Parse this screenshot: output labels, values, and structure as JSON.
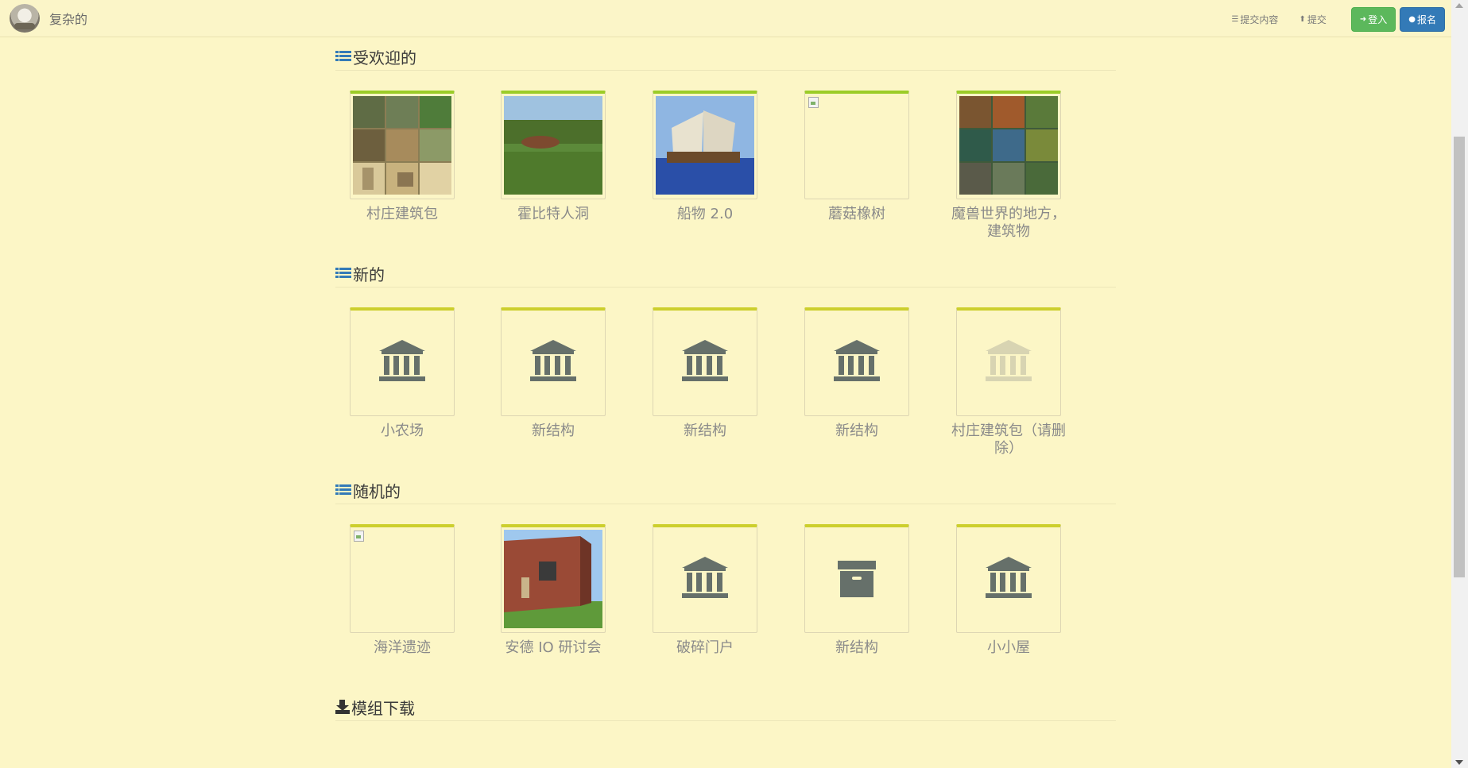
{
  "navbar": {
    "brand": "复杂的",
    "submissions_link": "提交内容",
    "submit_link": "提交",
    "login_button": "登入",
    "signup_button": "报名"
  },
  "sections": [
    {
      "title": "受欢迎的",
      "items": [
        {
          "label": "村庄建筑包",
          "thumb": "image"
        },
        {
          "label": "霍比特人洞",
          "thumb": "image"
        },
        {
          "label": "船物 2.0",
          "thumb": "image"
        },
        {
          "label": "蘑菇橡树",
          "thumb": "broken-image"
        },
        {
          "label": "魔兽世界的地方，建筑物",
          "thumb": "image"
        }
      ]
    },
    {
      "title": "新的",
      "items": [
        {
          "label": "小农场",
          "thumb": "bank-icon"
        },
        {
          "label": "新结构",
          "thumb": "bank-icon"
        },
        {
          "label": "新结构",
          "thumb": "bank-icon"
        },
        {
          "label": "新结构",
          "thumb": "bank-icon"
        },
        {
          "label": "村庄建筑包（请删除）",
          "thumb": "bank-icon-faded"
        }
      ]
    },
    {
      "title": "随机的",
      "items": [
        {
          "label": "海洋遗迹",
          "thumb": "broken-image"
        },
        {
          "label": "安德 IO 研讨会",
          "thumb": "image"
        },
        {
          "label": "破碎门户",
          "thumb": "bank-icon"
        },
        {
          "label": "新结构",
          "thumb": "archive-icon"
        },
        {
          "label": "小小屋",
          "thumb": "bank-icon"
        }
      ]
    },
    {
      "title": "模组下载",
      "items": []
    }
  ],
  "colors": {
    "background": "#fcf6c6",
    "popular_border": "#9bcc28",
    "new_border": "#cccf2d",
    "login_green": "#5cb85c",
    "signup_blue": "#337ab7"
  }
}
